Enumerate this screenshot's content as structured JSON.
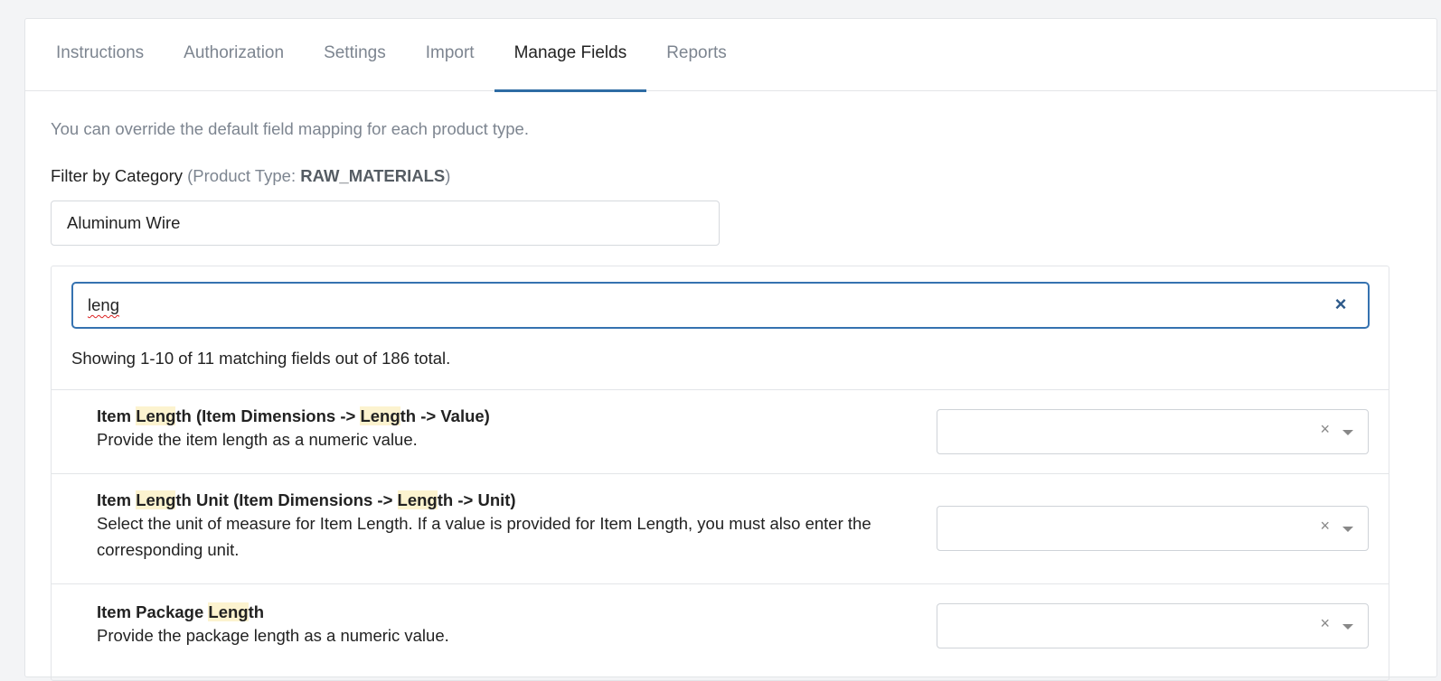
{
  "tabs": [
    {
      "label": "Instructions"
    },
    {
      "label": "Authorization"
    },
    {
      "label": "Settings"
    },
    {
      "label": "Import"
    },
    {
      "label": "Manage Fields",
      "active": true
    },
    {
      "label": "Reports"
    }
  ],
  "intro": "You can override the default field mapping for each product type.",
  "filter": {
    "label": "Filter by Category",
    "product_type_prefix": "(Product Type: ",
    "product_type": "RAW_MATERIALS",
    "product_type_suffix": ")",
    "category_value": "Aluminum Wire"
  },
  "search": {
    "value": "leng",
    "clear_glyph": "×"
  },
  "match_count": "Showing 1-10 of 11 matching fields out of 186 total.",
  "rows": [
    {
      "title_parts": [
        "Item ",
        "Leng",
        "th (Item Dimensions -> ",
        "Leng",
        "th -> Value)"
      ],
      "desc": "Provide the item length as a numeric value.",
      "select_value": ""
    },
    {
      "title_parts": [
        "Item ",
        "Leng",
        "th Unit (Item Dimensions -> ",
        "Leng",
        "th -> Unit)"
      ],
      "desc_lines": [
        "Select the unit of measure for Item Length. If a value is provided for Item Length, you must also enter the",
        "corresponding unit."
      ],
      "select_value": ""
    },
    {
      "title_parts": [
        "Item Package ",
        "Leng",
        "th"
      ],
      "desc": "Provide the package length as a numeric value.",
      "select_value": ""
    }
  ],
  "select": {
    "clear_glyph": "×",
    "caret_icon": "caret-down-icon"
  },
  "colors": {
    "accent": "#2e6ca4",
    "search_border": "#3572b0",
    "highlight": "#fcf3cf",
    "muted_text": "#7d8590"
  }
}
